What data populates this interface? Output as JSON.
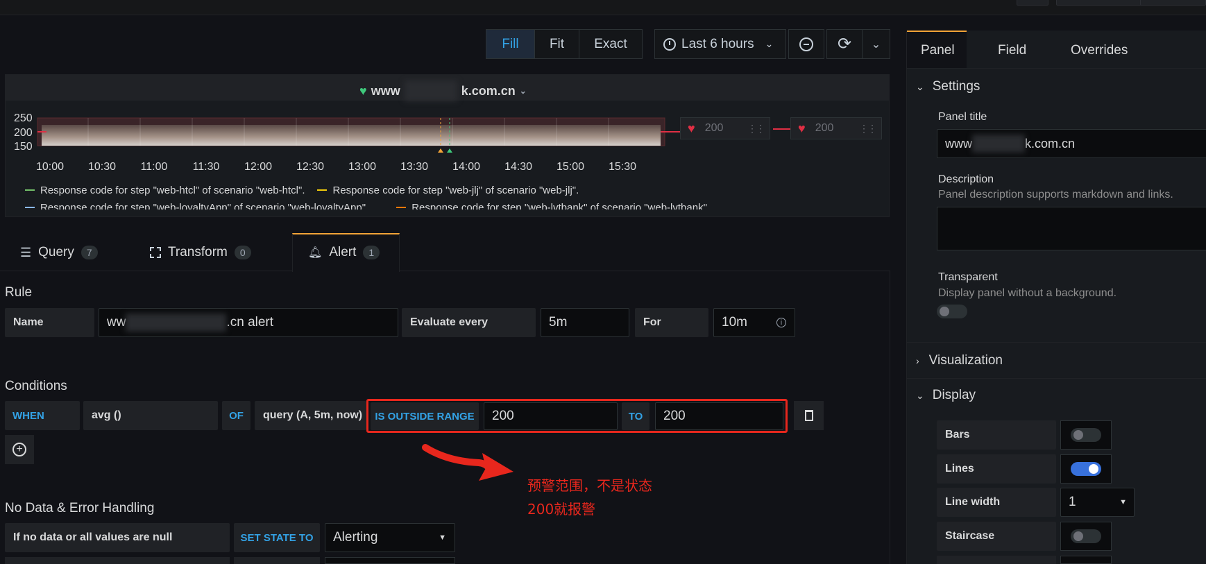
{
  "toolbar": {
    "fill": "Fill",
    "fit": "Fit",
    "exact": "Exact",
    "time_range": "Last 6 hours"
  },
  "panel": {
    "title_prefix": "www",
    "title_suffix": "k.com.cn",
    "y_ticks": [
      "250",
      "200",
      "150"
    ],
    "x_ticks": [
      "10:00",
      "10:30",
      "11:00",
      "11:30",
      "12:00",
      "12:30",
      "13:00",
      "13:30",
      "14:00",
      "14:30",
      "15:00",
      "15:30"
    ],
    "legend": [
      "Response code for step \"web-htcl\" of scenario \"web-htcl\".",
      "Response code for step \"web-jlj\" of scenario \"web-jlj\".",
      "Response code for step \"web-loyaltyApp\" of scenario \"web-loyaltyApp\".",
      "Response code for step \"web-lvtbank\" of scenario \"web-lvtbank\"."
    ],
    "threshold_1": "200",
    "threshold_2": "200"
  },
  "tabs": {
    "query": "Query",
    "query_count": "7",
    "transform": "Transform",
    "transform_count": "0",
    "alert": "Alert",
    "alert_count": "1"
  },
  "rule": {
    "heading": "Rule",
    "name_label": "Name",
    "name_prefix": "ww",
    "name_suffix": ".cn alert",
    "evaluate_label": "Evaluate every",
    "evaluate_value": "5m",
    "for_label": "For",
    "for_value": "10m"
  },
  "conditions": {
    "heading": "Conditions",
    "when": "WHEN",
    "func": "avg ()",
    "of": "OF",
    "query": "query (A, 5m, now)",
    "evaluator": "IS OUTSIDE RANGE",
    "from": "200",
    "to_label": "TO",
    "to": "200"
  },
  "annotation": {
    "line1": "预警范围，不是状态",
    "line2": "200就报警",
    "color": "#e8271d"
  },
  "nodata": {
    "heading": "No Data & Error Handling",
    "label": "If no data or all values are null",
    "set_state": "SET STATE TO",
    "state": "Alerting"
  },
  "right": {
    "tabs": [
      "Panel",
      "Field",
      "Overrides"
    ],
    "settings": "Settings",
    "panel_title_label": "Panel title",
    "panel_title_prefix": "www",
    "panel_title_suffix": "k.com.cn",
    "description_label": "Description",
    "description_help": "Panel description supports markdown and links.",
    "transparent_label": "Transparent",
    "transparent_help": "Display panel without a background.",
    "visualization": "Visualization",
    "display": "Display",
    "bars": "Bars",
    "lines": "Lines",
    "line_width": "Line width",
    "line_width_value": "1",
    "staircase": "Staircase"
  }
}
